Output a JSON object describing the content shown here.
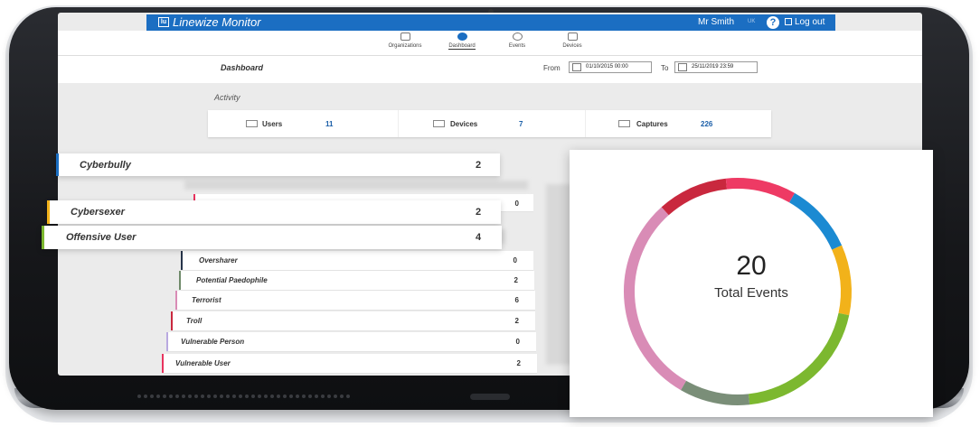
{
  "app": {
    "title": "Linewize Monitor",
    "logo_text": "lu",
    "user_name": "Mr Smith",
    "locale": "UK",
    "help": "?",
    "logout": "Log out"
  },
  "nav": [
    {
      "label": "Organizations",
      "icon": "building-icon"
    },
    {
      "label": "Dashboard",
      "icon": "dashboard-icon"
    },
    {
      "label": "Events",
      "icon": "search-icon"
    },
    {
      "label": "Devices",
      "icon": "devices-icon"
    }
  ],
  "dashboard": {
    "title": "Dashboard",
    "from_label": "From",
    "from_date": "01/10/2015 00:00",
    "to_label": "To",
    "to_date": "25/11/2019 23:59"
  },
  "activity": {
    "label": "Activity",
    "stats": [
      {
        "label": "Users",
        "value": "11",
        "icon": "users-icon"
      },
      {
        "label": "Devices",
        "value": "7",
        "icon": "devices-icon"
      },
      {
        "label": "Captures",
        "value": "226",
        "icon": "camera-icon"
      }
    ]
  },
  "floating_rows": [
    {
      "label": "Cyberbully",
      "count": "2",
      "color": "#1b6ec2"
    },
    {
      "label": "Cybersexer",
      "count": "2",
      "color": "#f2b21a"
    },
    {
      "label": "Offensive User",
      "count": "4",
      "color": "#7cb82f"
    }
  ],
  "hidden_row_count": "0",
  "event_rows": [
    {
      "label": "Oversharer",
      "count": "0",
      "color": "#26344a"
    },
    {
      "label": "Potential Paedophile",
      "count": "2",
      "color": "#6f8a6a"
    },
    {
      "label": "Terrorist",
      "count": "6",
      "color": "#d98cb6"
    },
    {
      "label": "Troll",
      "count": "2",
      "color": "#c9283e"
    },
    {
      "label": "Vulnerable Person",
      "count": "0",
      "color": "#b9a9e0"
    },
    {
      "label": "Vulnerable User",
      "count": "2",
      "color": "#e8335e"
    }
  ],
  "chart_data": {
    "type": "pie",
    "title": "",
    "total_value": "20",
    "total_label": "Total Events",
    "segments": [
      {
        "name": "Cyberbully",
        "value": 2,
        "color": "#1b8ad2"
      },
      {
        "name": "Cybersexer",
        "value": 2,
        "color": "#f2b21a"
      },
      {
        "name": "Offensive User",
        "value": 4,
        "color": "#7cb82f"
      },
      {
        "name": "Potential Paedophile",
        "value": 2,
        "color": "#7a8e78"
      },
      {
        "name": "Terrorist",
        "value": 6,
        "color": "#d98cb6"
      },
      {
        "name": "Troll",
        "value": 2,
        "color": "#c9283e"
      },
      {
        "name": "Vulnerable User",
        "value": 2,
        "color": "#ee3a64"
      }
    ]
  }
}
